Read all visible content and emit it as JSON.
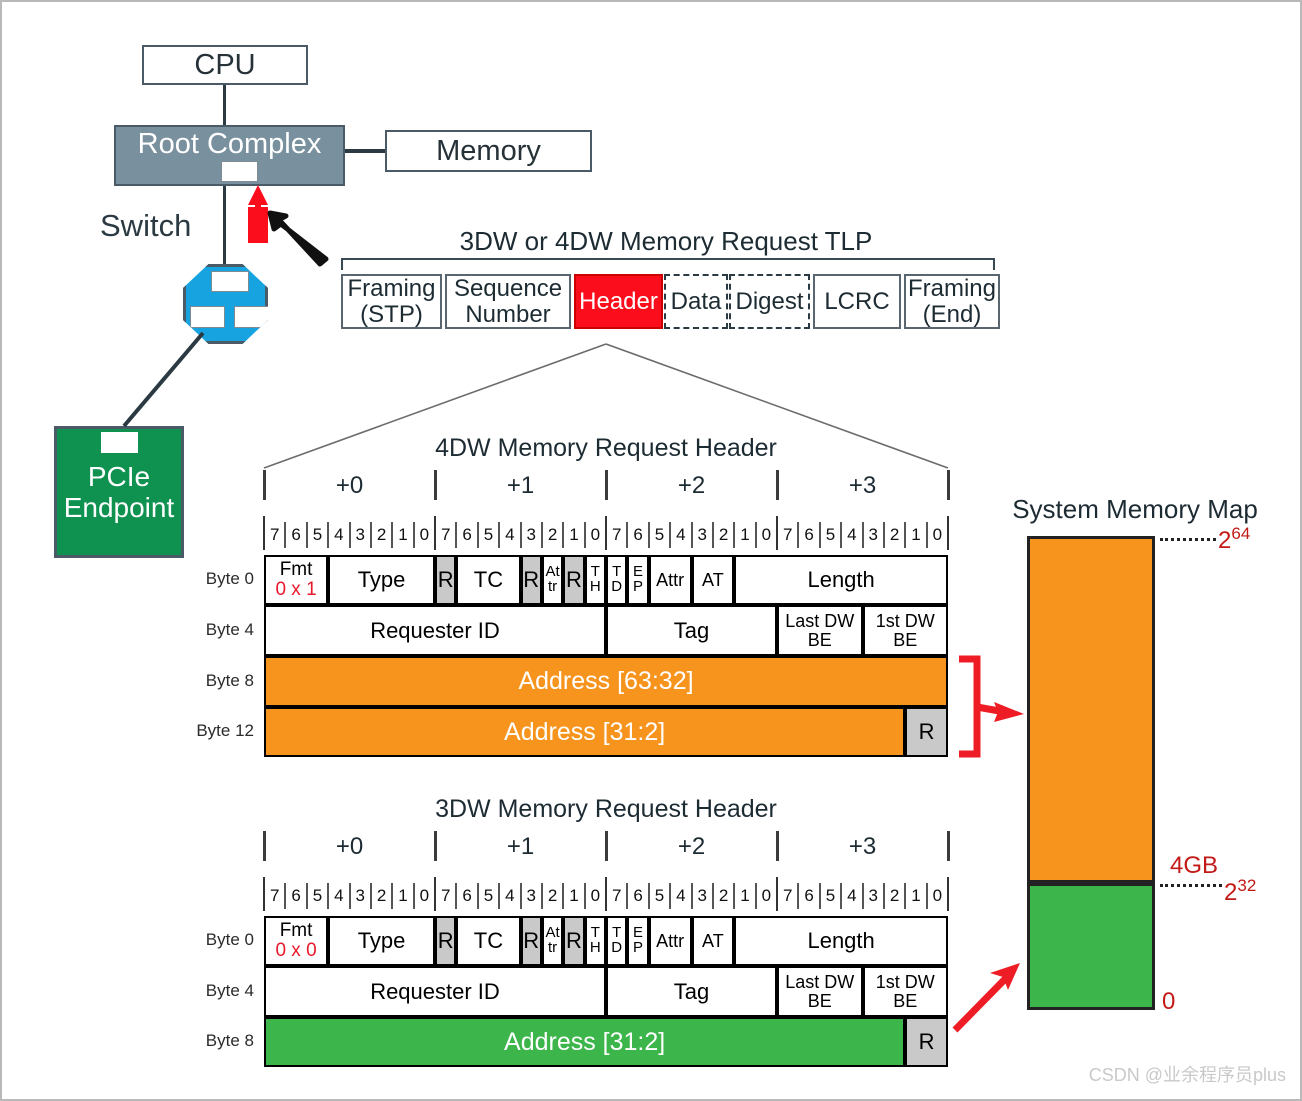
{
  "topology": {
    "cpu_label": "CPU",
    "root_complex_label": "Root Complex",
    "memory_label": "Memory",
    "switch_label": "Switch",
    "endpoint_label_line1": "PCIe",
    "endpoint_label_line2": "Endpoint"
  },
  "tlp": {
    "title": "3DW or 4DW Memory Request TLP",
    "cells": [
      {
        "line1": "Framing",
        "line2": "(STP)",
        "style": "solid"
      },
      {
        "line1": "Sequence",
        "line2": "Number",
        "style": "solid"
      },
      {
        "line1": "Header",
        "line2": "",
        "style": "red"
      },
      {
        "line1": "Data",
        "line2": "",
        "style": "dashed"
      },
      {
        "line1": "Digest",
        "line2": "",
        "style": "dashed"
      },
      {
        "line1": "LCRC",
        "line2": "",
        "style": "solid"
      },
      {
        "line1": "Framing",
        "line2": "(End)",
        "style": "solid"
      }
    ]
  },
  "header_4dw": {
    "title": "4DW Memory Request Header",
    "byte_offsets": [
      "+0",
      "+1",
      "+2",
      "+3"
    ],
    "bit_numbers": [
      "7",
      "6",
      "5",
      "4",
      "3",
      "2",
      "1",
      "0",
      "7",
      "6",
      "5",
      "4",
      "3",
      "2",
      "1",
      "0",
      "7",
      "6",
      "5",
      "4",
      "3",
      "2",
      "1",
      "0",
      "7",
      "6",
      "5",
      "4",
      "3",
      "2",
      "1",
      "0"
    ],
    "row_labels": [
      "Byte 0",
      "Byte 4",
      "Byte 8",
      "Byte 12"
    ],
    "row0_fields": [
      {
        "label": "Fmt",
        "value": "0 x 1",
        "bits": 3,
        "style": "fmt"
      },
      {
        "label": "Type",
        "bits": 5,
        "style": "plain"
      },
      {
        "label": "R",
        "bits": 1,
        "style": "gray"
      },
      {
        "label": "TC",
        "bits": 3,
        "style": "plain"
      },
      {
        "label": "R",
        "bits": 1,
        "style": "gray"
      },
      {
        "label": "At\ntr",
        "bits": 1,
        "style": "tiny"
      },
      {
        "label": "R",
        "bits": 1,
        "style": "gray"
      },
      {
        "label": "T\nH",
        "bits": 1,
        "style": "tiny"
      },
      {
        "label": "T\nD",
        "bits": 1,
        "style": "tiny"
      },
      {
        "label": "E\nP",
        "bits": 1,
        "style": "tiny"
      },
      {
        "label": "Attr",
        "bits": 2,
        "style": "small"
      },
      {
        "label": "AT",
        "bits": 2,
        "style": "small"
      },
      {
        "label": "Length",
        "bits": 10,
        "style": "plain"
      }
    ],
    "row1_fields": [
      {
        "label": "Requester ID",
        "bits": 16,
        "style": "plain"
      },
      {
        "label": "Tag",
        "bits": 8,
        "style": "plain"
      },
      {
        "label": "Last DW\nBE",
        "bits": 4,
        "style": "small"
      },
      {
        "label": "1st DW\nBE",
        "bits": 4,
        "style": "small"
      }
    ],
    "row2_fields": [
      {
        "label": "Address [63:32]",
        "bits": 32,
        "style": "orange"
      }
    ],
    "row3_fields": [
      {
        "label": "Address [31:2]",
        "bits": 30,
        "style": "orange"
      },
      {
        "label": "R",
        "bits": 2,
        "style": "gray"
      }
    ]
  },
  "header_3dw": {
    "title": "3DW Memory Request Header",
    "byte_offsets": [
      "+0",
      "+1",
      "+2",
      "+3"
    ],
    "bit_numbers": [
      "7",
      "6",
      "5",
      "4",
      "3",
      "2",
      "1",
      "0",
      "7",
      "6",
      "5",
      "4",
      "3",
      "2",
      "1",
      "0",
      "7",
      "6",
      "5",
      "4",
      "3",
      "2",
      "1",
      "0",
      "7",
      "6",
      "5",
      "4",
      "3",
      "2",
      "1",
      "0"
    ],
    "row_labels": [
      "Byte 0",
      "Byte 4",
      "Byte 8"
    ],
    "row0_fields": [
      {
        "label": "Fmt",
        "value": "0 x 0",
        "bits": 3,
        "style": "fmt"
      },
      {
        "label": "Type",
        "bits": 5,
        "style": "plain"
      },
      {
        "label": "R",
        "bits": 1,
        "style": "gray"
      },
      {
        "label": "TC",
        "bits": 3,
        "style": "plain"
      },
      {
        "label": "R",
        "bits": 1,
        "style": "gray"
      },
      {
        "label": "At\ntr",
        "bits": 1,
        "style": "tiny"
      },
      {
        "label": "R",
        "bits": 1,
        "style": "gray"
      },
      {
        "label": "T\nH",
        "bits": 1,
        "style": "tiny"
      },
      {
        "label": "T\nD",
        "bits": 1,
        "style": "tiny"
      },
      {
        "label": "E\nP",
        "bits": 1,
        "style": "tiny"
      },
      {
        "label": "Attr",
        "bits": 2,
        "style": "small"
      },
      {
        "label": "AT",
        "bits": 2,
        "style": "small"
      },
      {
        "label": "Length",
        "bits": 10,
        "style": "plain"
      }
    ],
    "row1_fields": [
      {
        "label": "Requester ID",
        "bits": 16,
        "style": "plain"
      },
      {
        "label": "Tag",
        "bits": 8,
        "style": "plain"
      },
      {
        "label": "Last DW\nBE",
        "bits": 4,
        "style": "small"
      },
      {
        "label": "1st DW\nBE",
        "bits": 4,
        "style": "small"
      }
    ],
    "row2_fields": [
      {
        "label": "Address [31:2]",
        "bits": 30,
        "style": "green"
      },
      {
        "label": "R",
        "bits": 2,
        "style": "gray"
      }
    ]
  },
  "memory_map": {
    "title": "System Memory Map",
    "top_label": "2",
    "top_exp": "64",
    "mid_label_gb": "4GB",
    "mid_label": "2",
    "mid_exp": "32",
    "bottom_label": "0",
    "upper_region_color": "#f7941e",
    "lower_region_color": "#3cb54a"
  },
  "watermark": "CSDN @业余程序员plus",
  "colors": {
    "orange": "#f7941e",
    "green": "#3cb54a",
    "red": "#e8192c",
    "tlp_header_red": "#fc0d1b",
    "root_complex": "#79909e",
    "switch_blue": "#17a3e0",
    "endpoint_green": "#0f9150"
  }
}
